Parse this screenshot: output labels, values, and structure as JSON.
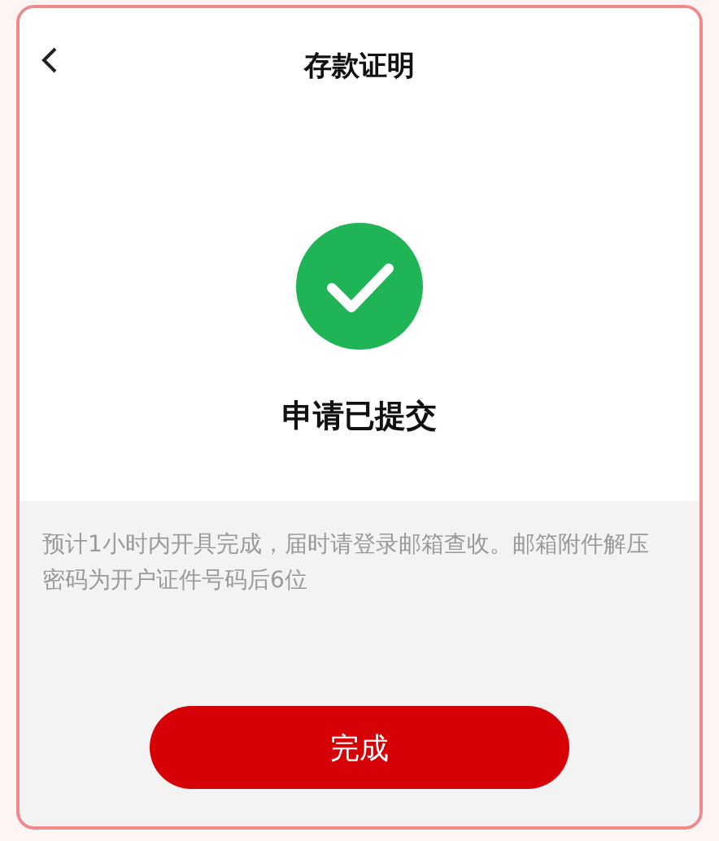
{
  "header": {
    "title": "存款证明"
  },
  "status": {
    "kind": "success",
    "message": "申请已提交"
  },
  "note": "预计1小时内开具完成，届时请登录邮箱查收。邮箱附件解压密码为开户证件号码后6位",
  "button": "完成"
}
